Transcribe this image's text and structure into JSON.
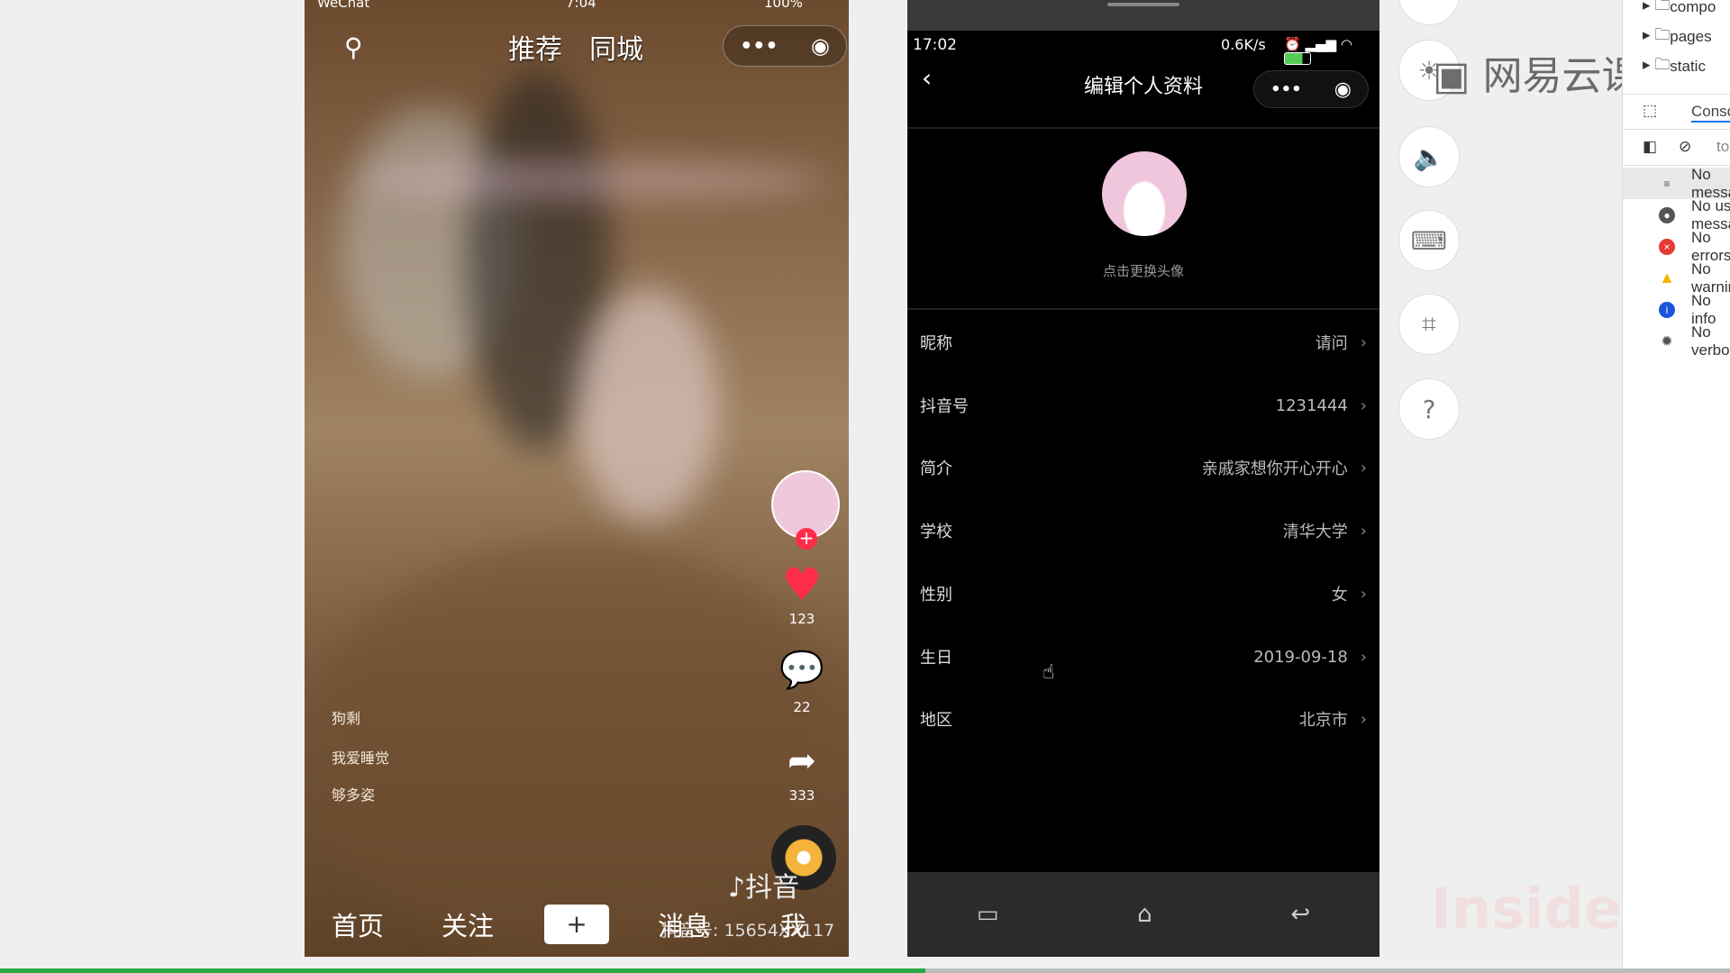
{
  "left_phone": {
    "status_carrier": "WeChat",
    "status_time": "7:04",
    "status_battery": "100%",
    "tabs": [
      "推荐",
      "同城"
    ],
    "likes": "123",
    "comments": "22",
    "shares": "333",
    "captions": [
      "狗剩",
      "我爱睡觉",
      "够多姿"
    ],
    "watermark_brand": "抖音",
    "watermark_id": "抖音号: 15654XX117",
    "nav": [
      "首页",
      "关注",
      "+",
      "消息",
      "我"
    ]
  },
  "right_phone": {
    "status_time": "17:02",
    "status_speed": "0.6K/s",
    "title": "编辑个人资料",
    "avatar_hint": "点击更换头像",
    "rows": [
      {
        "label": "昵称",
        "value": "请问"
      },
      {
        "label": "抖音号",
        "value": "1231444"
      },
      {
        "label": "简介",
        "value": "亲戚家想你开心开心"
      },
      {
        "label": "学校",
        "value": "清华大学"
      },
      {
        "label": "性别",
        "value": "女"
      },
      {
        "label": "生日",
        "value": "2019-09-18"
      },
      {
        "label": "地区",
        "value": "北京市"
      }
    ]
  },
  "overlay_logo": "网易云课堂",
  "overlay_watermark": "InsideRIA",
  "devtools": {
    "tree": [
      "compo",
      "pages",
      "static"
    ],
    "tab": "Console",
    "filter": "to",
    "messages": [
      "No messages",
      "No user messages",
      "No errors",
      "No warnings",
      "No info",
      "No verbose"
    ]
  },
  "colors": {
    "like": "#ff2b4a",
    "progress": "#2aa845"
  },
  "progress": 0.535
}
